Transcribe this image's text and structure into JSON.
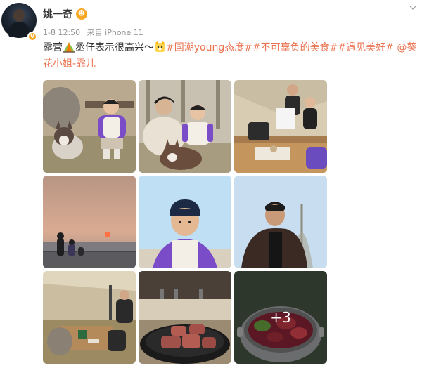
{
  "post": {
    "username": "姚一奇",
    "time": "1-8 12:50",
    "source": "来自 iPhone 11",
    "text": {
      "part1": "露营",
      "part2": "丞仔表示很高兴～",
      "hashtags": "#国潮young态度##不可辜负的美食##遇见美好#",
      "mention": "@葵花小姐-霏儿"
    }
  },
  "gallery": {
    "more_count": "+3",
    "images": [
      "photo-child-with-husky",
      "photo-family-with-husky",
      "photo-tent-cooking",
      "photo-sunset-lake",
      "photo-child-portrait",
      "photo-man-portrait",
      "photo-camp-table",
      "photo-steak-grill",
      "photo-hotpot"
    ]
  },
  "colors": {
    "link": "#eb7350",
    "meta": "#939393",
    "verified_badge": "#f5a623"
  }
}
